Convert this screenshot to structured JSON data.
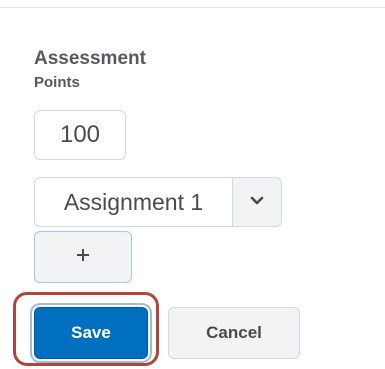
{
  "form": {
    "heading": "Assessment",
    "subheading": "Points",
    "points_value": "100",
    "assignment_select": {
      "selected": "Assignment 1",
      "caret_icon": "chevron-down-icon"
    },
    "add_icon": "plus-icon"
  },
  "actions": {
    "save_label": "Save",
    "cancel_label": "Cancel"
  },
  "colors": {
    "primary": "#006fbf",
    "highlight_ring": "#b0453d",
    "border": "#d3d9e3",
    "secondary_bg": "#f1f3f5",
    "text": "#494c4e"
  }
}
